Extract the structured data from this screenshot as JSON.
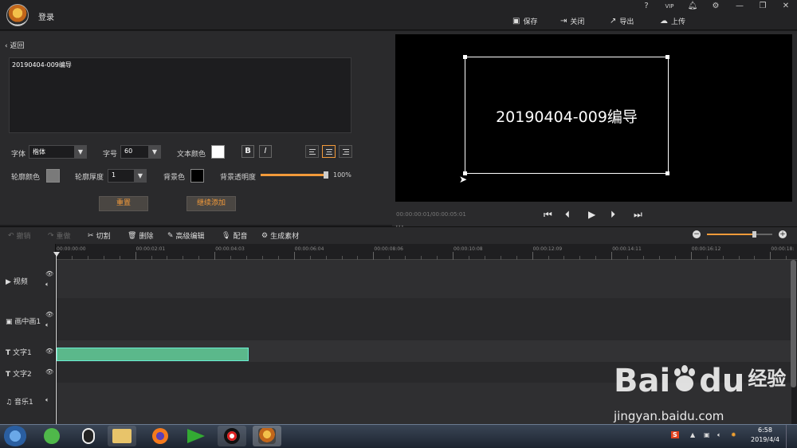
{
  "titlebar": {
    "login": "登录",
    "window_icons": [
      "?",
      "VIP",
      "bell",
      "gear",
      "—",
      "❐",
      "✕"
    ],
    "actions": [
      {
        "label": "保存",
        "icon": "save-icon"
      },
      {
        "label": "关闭",
        "icon": "close-icon"
      },
      {
        "label": "导出",
        "icon": "export-icon"
      },
      {
        "label": "上传",
        "icon": "upload-icon"
      }
    ]
  },
  "editor": {
    "back_label": "返回",
    "text_value": "20190404-009编导",
    "font_label": "字体",
    "font_value": "楷体",
    "size_label": "字号",
    "size_value": "60",
    "text_color_label": "文本颜色",
    "text_color": "#ffffff",
    "bold_label": "B",
    "italic_label": "I",
    "outline_color_label": "轮廓颜色",
    "outline_color": "#7a7a7a",
    "outline_width_label": "轮廓厚度",
    "outline_width_value": "1",
    "bg_color_label": "背景色",
    "bg_color": "#000000",
    "bg_opacity_label": "背景透明度",
    "bg_opacity_value": "100%",
    "bg_opacity_fraction": 1.0,
    "reset_label": "重置",
    "continue_label": "继续添加",
    "accent": "#f29a3a"
  },
  "preview": {
    "overlay_text": "20190404-009编导",
    "timecode": "00:00:00:01/00:00:05:01",
    "controls": [
      "skip-start",
      "step-back",
      "play",
      "step-forward",
      "skip-end"
    ]
  },
  "toolbar": {
    "undo": "撤销",
    "redo": "重做",
    "cut": "切割",
    "delete": "删除",
    "advanced": "高级编辑",
    "dub": "配音",
    "generate": "生成素材",
    "zoom_fraction": 0.72
  },
  "timeline": {
    "ticks": [
      "00:00:00:00",
      "00:00:02:01",
      "00:00:04:03",
      "00:00:06:04",
      "00:00:08:06",
      "00:00:10:08",
      "00:00:12:09",
      "00:00:14:11",
      "00:00:16:12",
      "00:00:18:"
    ],
    "tracks": [
      {
        "label": "视频",
        "icon": "video-track-icon"
      },
      {
        "label": "画中画1",
        "icon": "pip-track-icon"
      },
      {
        "label": "文字1",
        "icon": "text-track-icon"
      },
      {
        "label": "文字2",
        "icon": "text-track-icon"
      },
      {
        "label": "音乐1",
        "icon": "music-track-icon"
      }
    ],
    "clip_color": "#5bb88b"
  },
  "taskbar": {
    "time": "6:58",
    "date": "2019/4/4"
  },
  "watermark": {
    "brand": "Bai",
    "brand2": "du",
    "cn": "经验",
    "url": "jingyan.baidu.com"
  }
}
